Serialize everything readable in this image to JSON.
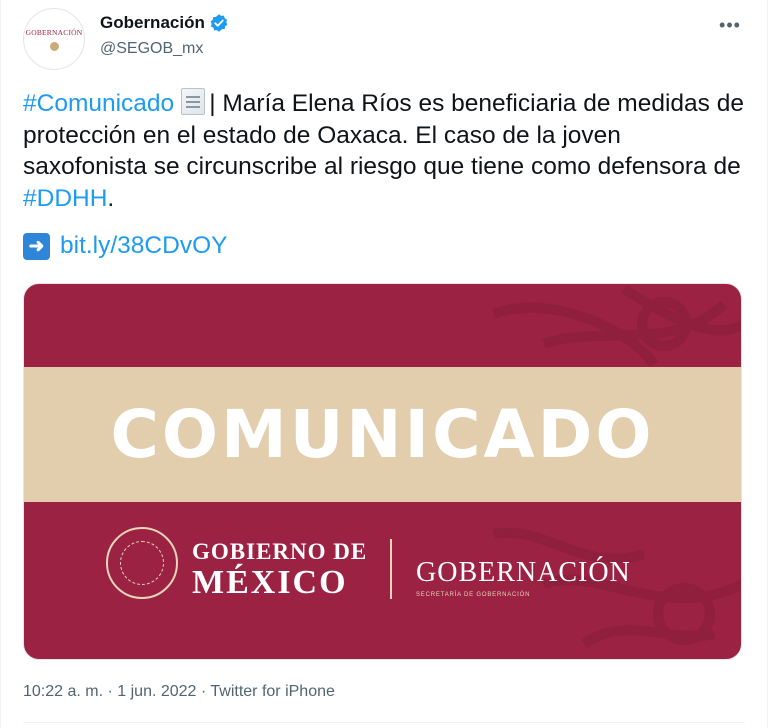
{
  "author": {
    "avatar_text": "GOBERNACIÓN",
    "display_name": "Gobernación",
    "handle": "@SEGOB_mx",
    "verified": true
  },
  "more_icon": "more-horizontal-icon",
  "tweet": {
    "hashtag_comunicado": "#Comunicado",
    "text_part1": "| María Elena Ríos es beneficiaria de medidas de protección en el estado de Oaxaca. El caso de la joven saxofonista se circunscribe al riesgo que tiene como defensora de ",
    "hashtag_ddhh": "#DDHH",
    "text_part2": ".",
    "link": "bit.ly/38CDvOY"
  },
  "media": {
    "headline": "COMUNICADO",
    "gobierno_line1": "GOBIERNO DE",
    "gobierno_line2": "MÉXICO",
    "dependency": "GOBERNACIÓN",
    "dependency_sub": "SECRETARÍA DE GOBERNACIÓN",
    "colors": {
      "background": "#9b2243",
      "band": "#e2cdac",
      "accent": "#e7d4b8"
    }
  },
  "meta": {
    "time": "10:22 a. m.",
    "sep1": " · ",
    "date": "1 jun. 2022",
    "sep2": " · ",
    "source": "Twitter for iPhone"
  },
  "colors": {
    "link": "#1d9bf0",
    "muted": "#536471",
    "text": "#0f1419"
  }
}
